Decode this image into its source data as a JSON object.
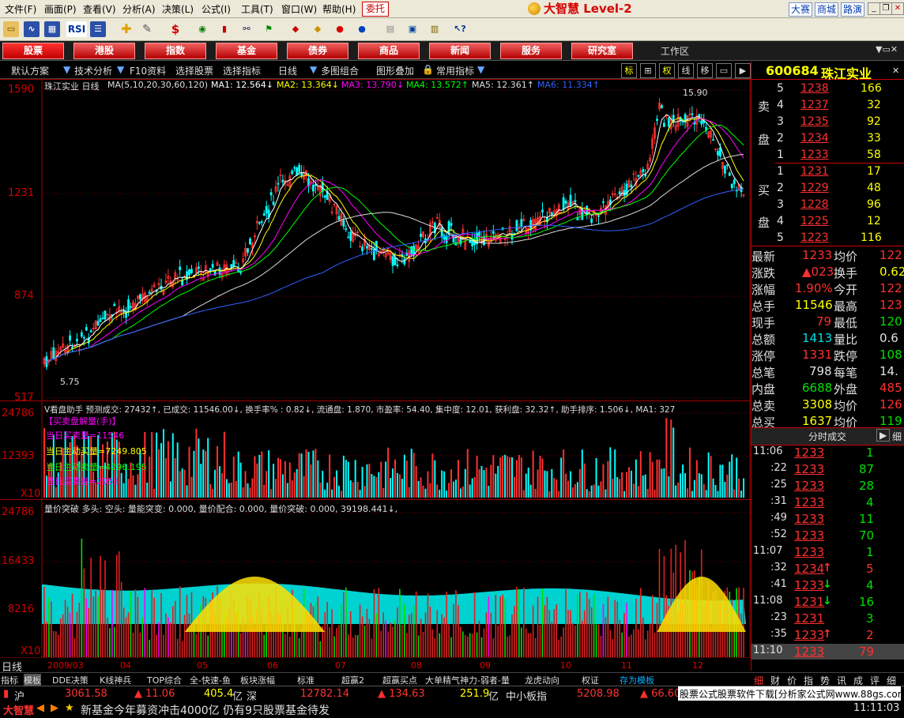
{
  "menu": {
    "items": [
      "文件(F)",
      "画面(P)",
      "查看(V)",
      "分析(A)",
      "决策(L)",
      "公式(I)",
      "工具(T)",
      "窗口(W)",
      "帮助(H)"
    ],
    "trade": "委托",
    "logo": "大智慧 Level-2",
    "links": [
      "大赛",
      "商城",
      "路演"
    ]
  },
  "toolbar": {
    "rsi": "RSI",
    "dollar": "$"
  },
  "nav": {
    "buttons": [
      "股票",
      "港股",
      "指数",
      "基金",
      "债券",
      "商品",
      "新闻",
      "服务",
      "研究室"
    ],
    "workarea": "工作区"
  },
  "subbar": {
    "items": [
      "默认方案",
      "技术分析",
      "F10资料",
      "选择股票",
      "选择指标",
      "日线",
      "多图组合",
      "图形叠加",
      "常用指标"
    ],
    "toggles": [
      "标",
      "权",
      "线",
      "移"
    ]
  },
  "chart": {
    "title": "珠江实业 日线",
    "ma_params": "MA(5,10,20,30,60,120)",
    "ma": [
      {
        "label": "MA1: 12.564↓",
        "color": "#ffffff"
      },
      {
        "label": "MA2: 13.364↓",
        "color": "#ffff00"
      },
      {
        "label": "MA3: 13.790↓",
        "color": "#ff00ff"
      },
      {
        "label": "MA4: 13.572↑",
        "color": "#00ff00"
      },
      {
        "label": "MA5: 12.361↑",
        "color": "#dddddd"
      },
      {
        "label": "MA6: 11.334↑",
        "color": "#3060ff"
      }
    ],
    "price_axis": [
      "1590",
      "1231",
      "874",
      "517"
    ],
    "high_mark": "15.90",
    "low_mark": "5.75",
    "vol_axis": [
      "24786",
      "12393",
      "X10"
    ],
    "ind_axis": [
      "24786",
      "16433",
      "8216",
      "X10"
    ],
    "dates": [
      "2009/03",
      "04",
      "05",
      "06",
      "07",
      "08",
      "09",
      "10",
      "11",
      "12"
    ],
    "period": "日线"
  },
  "vol_panel": {
    "header": "V看盘助手 预测成交: 27432↑, 已成交: 11546.00↓, 换手率% : 0.82↓, 流通盘: 1.870, 市盈率: 54.40, 集中度: 12.01, 获利盘: 32.32↑, 助手排序: 1.506↓, MA1: 327",
    "tag": "【买卖盘解量(手)】",
    "lines": [
      "当日买卖量=11546",
      "当日主动买量=7249.805",
      "当日主动卖量=4296.195",
      "当日买卖差=2953"
    ]
  },
  "ind_panel": {
    "header": "量价突破 多头: 空头: 量能突变: 0.000, 量价配合: 0.000, 量价突破: 0.000, 39198.441↓,"
  },
  "quote": {
    "code": "600684",
    "name": "珠江实业",
    "sell": [
      {
        "lvl": "5",
        "price": "1238",
        "vol": "166"
      },
      {
        "lvl": "4",
        "price": "1237",
        "vol": "32"
      },
      {
        "lvl": "3",
        "price": "1235",
        "vol": "92"
      },
      {
        "lvl": "2",
        "price": "1234",
        "vol": "33"
      },
      {
        "lvl": "1",
        "price": "1233",
        "vol": "58"
      }
    ],
    "buy": [
      {
        "lvl": "1",
        "price": "1231",
        "vol": "17"
      },
      {
        "lvl": "2",
        "price": "1229",
        "vol": "48"
      },
      {
        "lvl": "3",
        "price": "1228",
        "vol": "96"
      },
      {
        "lvl": "4",
        "price": "1225",
        "vol": "12"
      },
      {
        "lvl": "5",
        "price": "1223",
        "vol": "116"
      }
    ],
    "sell_label": [
      "卖",
      "盘"
    ],
    "buy_label": [
      "买",
      "盘"
    ],
    "stats": [
      {
        "l1": "最新",
        "v1": "1233",
        "c1": "red",
        "l2": "均价",
        "v2": "122",
        "c2": "red"
      },
      {
        "l1": "涨跌",
        "v1": "▲023",
        "c1": "red",
        "l2": "换手",
        "v2": "0.62",
        "c2": "yellow"
      },
      {
        "l1": "涨幅",
        "v1": "1.90%",
        "c1": "red",
        "l2": "今开",
        "v2": "122",
        "c2": "red"
      },
      {
        "l1": "总手",
        "v1": "11546",
        "c1": "yellow",
        "l2": "最高",
        "v2": "123",
        "c2": "red"
      },
      {
        "l1": "现手",
        "v1": "79",
        "c1": "red",
        "l2": "最低",
        "v2": "120",
        "c2": "green"
      },
      {
        "l1": "总额",
        "v1": "1413",
        "c1": "cyan",
        "l2": "量比",
        "v2": "0.6",
        "c2": "white"
      },
      {
        "l1": "涨停",
        "v1": "1331",
        "c1": "red",
        "l2": "跌停",
        "v2": "108",
        "c2": "green"
      },
      {
        "l1": "总笔",
        "v1": "798",
        "c1": "white",
        "l2": "每笔",
        "v2": "14.",
        "c2": "white"
      },
      {
        "l1": "内盘",
        "v1": "6688",
        "c1": "green",
        "l2": "外盘",
        "v2": "485",
        "c2": "red"
      },
      {
        "l1": "总卖",
        "v1": "3308",
        "c1": "yellow",
        "l2": "均价",
        "v2": "126",
        "c2": "red"
      },
      {
        "l1": "总买",
        "v1": "1637",
        "c1": "yellow",
        "l2": "均价",
        "v2": "119",
        "c2": "green"
      }
    ],
    "ticks_title": "分时成交",
    "ticks": [
      {
        "t": "11:06",
        "p": "1233",
        "pc": "red",
        "v": "1",
        "vc": "green",
        "a": ""
      },
      {
        "t": ":22",
        "p": "1233",
        "pc": "red",
        "v": "87",
        "vc": "green",
        "a": ""
      },
      {
        "t": ":25",
        "p": "1233",
        "pc": "red",
        "v": "28",
        "vc": "green",
        "a": ""
      },
      {
        "t": ":31",
        "p": "1233",
        "pc": "red",
        "v": "4",
        "vc": "green",
        "a": ""
      },
      {
        "t": ":49",
        "p": "1233",
        "pc": "red",
        "v": "11",
        "vc": "green",
        "a": ""
      },
      {
        "t": ":52",
        "p": "1233",
        "pc": "red",
        "v": "70",
        "vc": "green",
        "a": ""
      },
      {
        "t": "11:07",
        "p": "1233",
        "pc": "red",
        "v": "1",
        "vc": "green",
        "a": ""
      },
      {
        "t": ":32",
        "p": "1234",
        "pc": "red",
        "v": "5",
        "vc": "red",
        "a": "↑"
      },
      {
        "t": ":41",
        "p": "1233",
        "pc": "red",
        "v": "4",
        "vc": "green",
        "a": "↓"
      },
      {
        "t": "11:08",
        "p": "1231",
        "pc": "red",
        "v": "16",
        "vc": "green",
        "a": "↓"
      },
      {
        "t": ":23",
        "p": "1231",
        "pc": "red",
        "v": "3",
        "vc": "green",
        "a": ""
      },
      {
        "t": ":35",
        "p": "1233",
        "pc": "red",
        "v": "2",
        "vc": "red",
        "a": "↑"
      },
      {
        "t": "11:10",
        "p": "1233",
        "pc": "red",
        "v": "79",
        "vc": "red",
        "a": ""
      }
    ],
    "tabs": [
      "细",
      "财",
      "价",
      "指",
      "势",
      "讯",
      "成",
      "评",
      "细"
    ]
  },
  "bottom_tabs": [
    "指标",
    "模板",
    "DDE决策",
    "K线神兵",
    "TOP综合",
    "全-快速-鱼",
    "板块涨幅",
    "标准",
    "超赢2",
    "超赢买点",
    "大单精气神力-弱者-量",
    "龙虎动向",
    "权证",
    "存为模板"
  ],
  "status": {
    "sh_label": "沪",
    "sh_index": "3061.58",
    "sh_chg": "▲ 11.06",
    "sh_amt": "405.4",
    "sh_unit": "亿",
    "sz_label": "深",
    "sz_index": "12782.14",
    "sz_chg": "▲ 134.63",
    "sz_amt": "251.9",
    "sz_unit": "亿",
    "zx_label": "中小板指",
    "zx_index": "5208.98",
    "zx_chg": "▲ 66.60",
    "ad": "股票公式股票软件下载[分析家公式网www.88gs.com]",
    "brand": "大智慧",
    "news": "新基金今年募资冲击4000亿 仍有9只股票基金待发",
    "time": "11:11:03"
  }
}
